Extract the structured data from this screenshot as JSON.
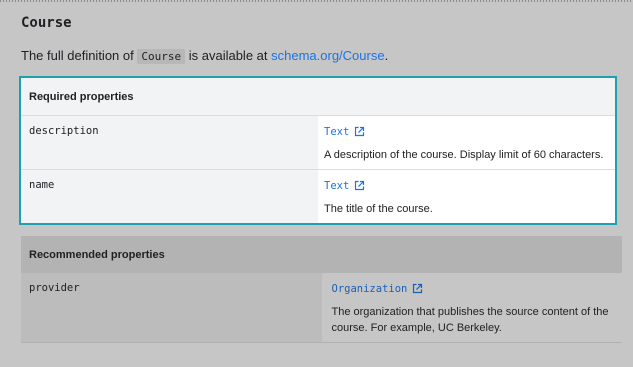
{
  "heading": "Course",
  "intro": {
    "prefix": "The full definition of",
    "code": "Course",
    "middle": "is available at",
    "link_text": "schema.org/Course",
    "suffix": "."
  },
  "required": {
    "header": "Required properties",
    "rows": [
      {
        "name": "description",
        "type": "Text",
        "description": "A description of the course. Display limit of 60 characters."
      },
      {
        "name": "name",
        "type": "Text",
        "description": "The title of the course."
      }
    ]
  },
  "recommended": {
    "header": "Recommended properties",
    "rows": [
      {
        "name": "provider",
        "type": "Organization",
        "description": "The organization that publishes the source content of the course. For example, UC Berkeley."
      }
    ]
  },
  "icons": {
    "external_link": "external-link-icon"
  },
  "colors": {
    "link": "#1a73e8",
    "highlight_border": "#1ea0ad",
    "overlay": "#c6c6c6"
  }
}
